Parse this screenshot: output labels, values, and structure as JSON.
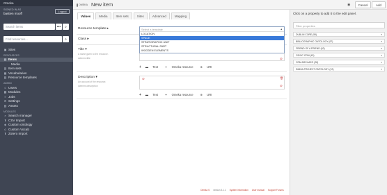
{
  "app": {
    "name": "Omeka"
  },
  "user": {
    "label": "SIGNED IN AS",
    "name": "bastien mooff",
    "logout_label": "Logout"
  },
  "sidebar": {
    "search_placeholder": "Search items",
    "find_placeholder": "Find resources...",
    "sites_label": "Sites",
    "resources_heading": "RESOURCES",
    "items_label": "Items",
    "media_label": "Media",
    "item_sets_label": "Item sets",
    "vocabularies_label": "Vocabularies",
    "resource_templates_label": "Resource templates",
    "admin_heading": "ADMIN",
    "users_label": "Users",
    "modules_label": "Modules",
    "jobs_label": "Jobs",
    "settings_label": "Settings",
    "assets_label": "Assets",
    "modules_heading": "MODULES",
    "search_manager_label": "Search manager",
    "csv_import_label": "CSV Import",
    "custom_ontology_label": "Custom ontology",
    "custom_vocab_label": "Custom Vocab",
    "zotero_import_label": "Zotero Import"
  },
  "header": {
    "logo_text": "OMEKA",
    "title": "New item",
    "cancel_label": "Cancel",
    "add_label": "Add"
  },
  "tabs": [
    "Values",
    "Media",
    "Item sets",
    "Sites",
    "Advanced",
    "Mapping"
  ],
  "form": {
    "resource_template_label": "Resource template",
    "class_label": "Class",
    "dropdown": {
      "search_placeholder": "Select a template",
      "options": [
        "LOCATION",
        "SPACE",
        "STRATIGRAPHIC UNIT",
        "STRUCTURAL PART",
        "WOODEN ELEMENTS"
      ],
      "selected_index": 1
    },
    "title_label": "Title",
    "title_desc": "A name given to the resource.",
    "title_term": "dcterms:title",
    "description_label": "Description",
    "description_desc": "An account of the resource.",
    "description_term": "dcterms:description",
    "add_text": "Text",
    "add_omeka": "Omeka resource",
    "add_uri": "URI"
  },
  "right_panel": {
    "heading": "Click on a property to add it to the edit panel.",
    "filter_placeholder": "Filter properties",
    "vocabularies": [
      "DUBLIN CORE (55)",
      "BIBLIOGRAPHIC ONTOLOGY (67)",
      "FRIEND OF A FRIEND (62)",
      "CIDOC CRM (43)",
      "CRM ARCHAEO (28)",
      "DIMHA PROJECT ONTOLOGY (12)"
    ]
  },
  "footer": {
    "brand": "Omeka S",
    "version": "version 3.1.1",
    "system_info": "System information",
    "user_manual": "User manual",
    "support": "Support Forums"
  },
  "colors": {
    "sidebar": "#3f4553",
    "accent": "#3879d9",
    "link": "#c0392b"
  }
}
